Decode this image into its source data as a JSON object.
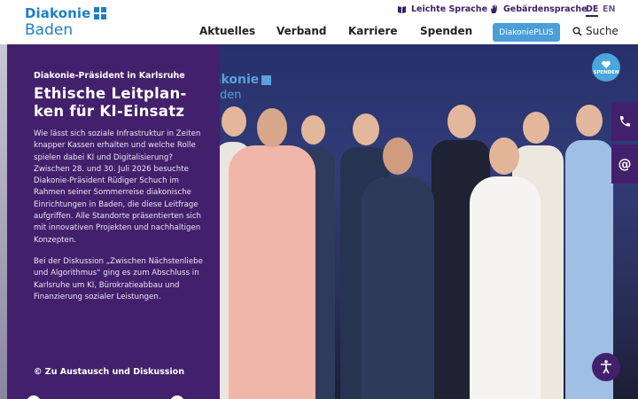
{
  "header": {
    "logo": {
      "name": "Diakonie",
      "region": "Baden"
    },
    "utility": {
      "easy_language": "Leichte Sprache",
      "sign_language": "Gebärdensprache",
      "languages": [
        "DE",
        "EN"
      ]
    },
    "nav": [
      "Aktuelles",
      "Verband",
      "Karriere",
      "Spenden"
    ],
    "plus_button": "DiakoniePLUS",
    "search_label": "Suche"
  },
  "hero": {
    "backdrop_logo": "akonie",
    "backdrop_sub": "aden"
  },
  "card": {
    "kicker": "Diakonie-Präsident in Karlsruhe",
    "title": "Ethische Leitplan-ken für KI-Einsatz",
    "paragraph1": "Wie lässt sich soziale Infrastruktur in Zeiten knapper Kassen erhalten und welche Rolle spielen dabei KI und Digitalisierung? Zwischen 28. und 30. Juli 2026 besuchte Diakonie-Präsident Rüdiger Schuch im Rahmen seiner Sommerreise diakonische Einrichtungen in Baden, die diese Leitfrage aufgriffen. Alle Standorte präsentierten sich mit innovativen Projekten und nachhaltigen Konzepten.",
    "paragraph2": "Bei der Diskussion „Zwischen Nächstenliebe und Algorithmus“ ging es zum Abschluss in Karlsruhe um KI, Bürokratieabbau und Finanzierung sozialer Leistungen.",
    "link": "© Zu Austausch und Diskussion"
  },
  "floating": {
    "donate_label": "SPENDEN",
    "mail_symbol": "@"
  },
  "colors": {
    "brand_blue": "#1f7fc4",
    "purple": "#43206c",
    "accent_light_blue": "#4a9fd8"
  }
}
